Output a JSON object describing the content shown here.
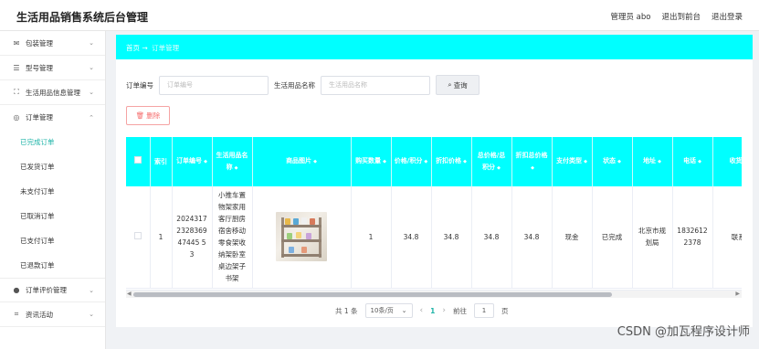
{
  "app": {
    "title": "生活用品销售系统后台管理"
  },
  "header": {
    "user": "管理员 abo",
    "front": "退出到前台",
    "logout": "退出登录"
  },
  "sidebar": {
    "menus": [
      {
        "label": "包装管理",
        "icon": "mail-icon"
      },
      {
        "label": "型号管理",
        "icon": "sliders-icon"
      },
      {
        "label": "生活用品信息管理",
        "icon": "fullscreen-icon"
      },
      {
        "label": "订单管理",
        "icon": "compass-icon",
        "expanded": true
      }
    ],
    "order_sub": [
      {
        "label": "已完成订单",
        "active": true
      },
      {
        "label": "已发货订单"
      },
      {
        "label": "未支付订单"
      },
      {
        "label": "已取消订单"
      },
      {
        "label": "已支付订单"
      },
      {
        "label": "已退款订单"
      }
    ],
    "menus_after": [
      {
        "label": "订单评价管理",
        "icon": "user-icon"
      },
      {
        "label": "资讯活动",
        "icon": "crop-icon"
      }
    ]
  },
  "breadcrumb": {
    "home": "首页",
    "sep": "→",
    "current": "订单管理"
  },
  "search": {
    "order_no_label": "订单编号",
    "order_no_placeholder": "订单编号",
    "goods_name_label": "生活用品名称",
    "goods_name_placeholder": "生活用品名称",
    "query_label": "查询"
  },
  "actions": {
    "delete_label": "删除"
  },
  "table": {
    "columns": [
      "索引",
      "订单编号",
      "生活用品名称",
      "商品图片",
      "购买数量",
      "价格/积分",
      "折扣价格",
      "总价格/总积分",
      "折扣总价格",
      "支付类型",
      "状态",
      "地址",
      "电话",
      "收货人"
    ],
    "rows": [
      {
        "index": "1",
        "order_no": "2024317232836947445 53",
        "name": "小推车置物架家用客厅厨房宿舍移动零食架收纳架卧室桌边架子书架",
        "qty": "1",
        "price": "34.8",
        "discount_price": "34.8",
        "total": "34.8",
        "discount_total": "34.8",
        "pay_type": "现金",
        "status": "已完成",
        "address": "北京市规划局",
        "phone": "18326122378",
        "receiver": "联系人"
      }
    ]
  },
  "pager": {
    "total": "共 1 条",
    "page_size": "10条/页",
    "current": "1",
    "goto_label": "前往",
    "goto_value": "1",
    "page_suffix": "页"
  },
  "watermark": "CSDN @加瓦程序设计师"
}
